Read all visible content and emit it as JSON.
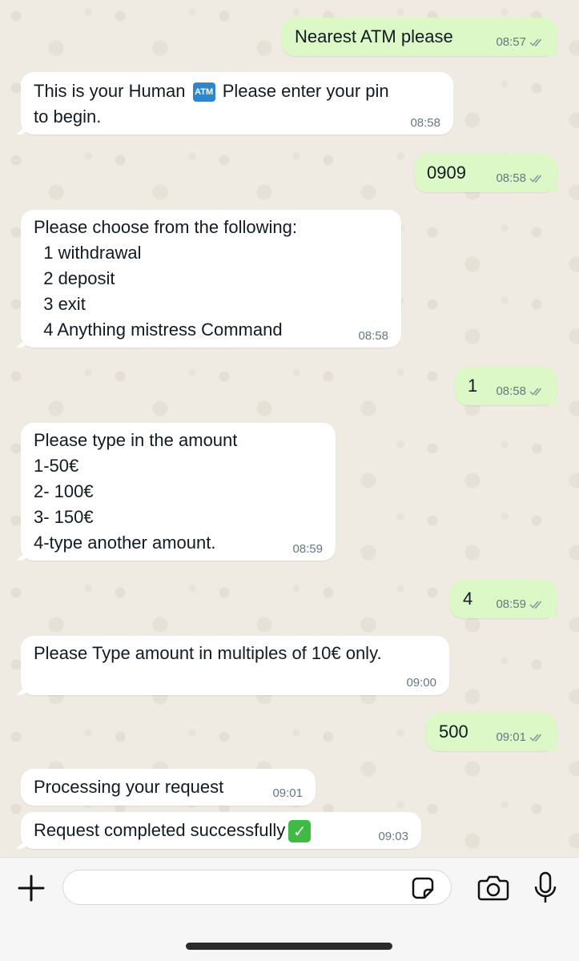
{
  "chat": {
    "messages": [
      {
        "direction": "out",
        "text": "Nearest ATM please",
        "time": "08:57",
        "status": "read"
      },
      {
        "direction": "in",
        "text_before_emoji": "This is your Human ",
        "emoji": "ATM",
        "emoji_name": "atm-sign",
        "text_after_emoji": " Please enter your pin",
        "text_line2": "to begin.",
        "time": "08:58"
      },
      {
        "direction": "out",
        "text": "0909",
        "time": "08:58",
        "status": "read"
      },
      {
        "direction": "in",
        "lines": [
          "Please choose from the following:",
          "  1 withdrawal",
          "  2 deposit",
          "  3 exit",
          "  4 Anything mistress Command"
        ],
        "time": "08:58"
      },
      {
        "direction": "out",
        "text": "1",
        "time": "08:58",
        "status": "read"
      },
      {
        "direction": "in",
        "lines": [
          "Please type in the amount",
          "1-50€",
          "2- 100€",
          "3- 150€",
          "4-type another amount."
        ],
        "time": "08:59"
      },
      {
        "direction": "out",
        "text": "4",
        "time": "08:59",
        "status": "read"
      },
      {
        "direction": "in",
        "text": "Please Type amount in multiples of 10€ only.",
        "time": "09:00"
      },
      {
        "direction": "out",
        "text": "500",
        "time": "09:01",
        "status": "read"
      },
      {
        "direction": "in",
        "text": "Processing your request",
        "time": "09:01"
      },
      {
        "direction": "in",
        "text": "Request completed successfully",
        "emoji_name": "check-mark-button",
        "time": "09:03"
      }
    ]
  },
  "input_bar": {
    "message_value": "",
    "icons": [
      "plus-icon",
      "sticker-icon",
      "camera-icon",
      "microphone-icon"
    ]
  },
  "colors": {
    "chat_background": "#efeae2",
    "outgoing_bubble": "#dcf8c6",
    "incoming_bubble": "#ffffff",
    "timestamp": "#667781",
    "read_ticks": "#8696a0"
  }
}
